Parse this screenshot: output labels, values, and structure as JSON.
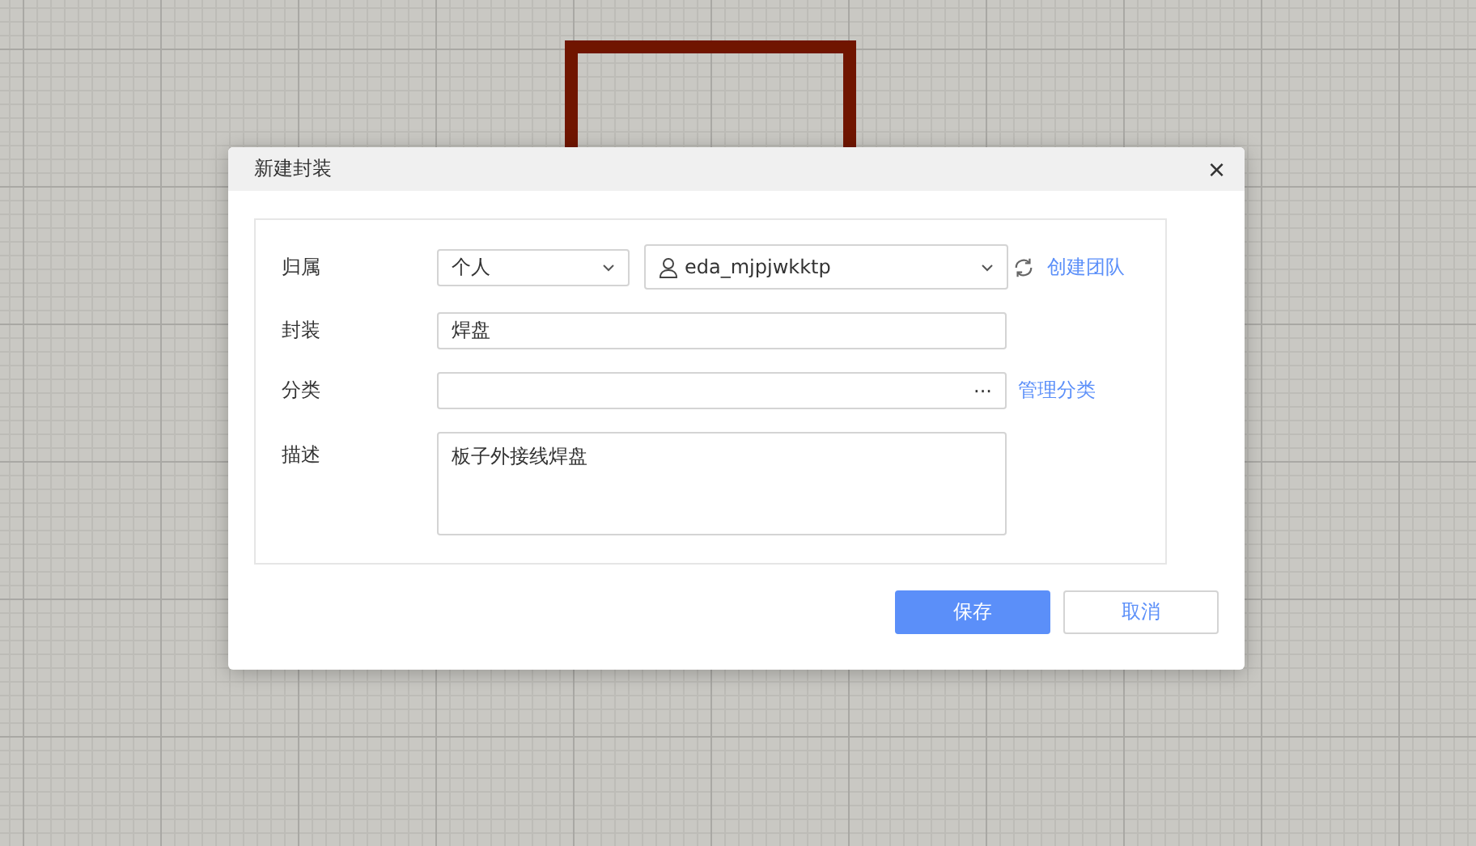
{
  "dialog": {
    "title": "新建封装",
    "close": "×"
  },
  "form": {
    "owner": {
      "label": "归属",
      "scope": "个人",
      "user": "eda_mjpjwkktp",
      "link": "创建团队"
    },
    "package": {
      "label": "封装",
      "value": "焊盘"
    },
    "category": {
      "label": "分类",
      "more": "···",
      "link": "管理分类"
    },
    "description": {
      "label": "描述",
      "value": "板子外接线焊盘"
    }
  },
  "buttons": [
    {
      "label": "保存",
      "kind": "primary"
    },
    {
      "label": "取消",
      "kind": "secondary"
    }
  ]
}
